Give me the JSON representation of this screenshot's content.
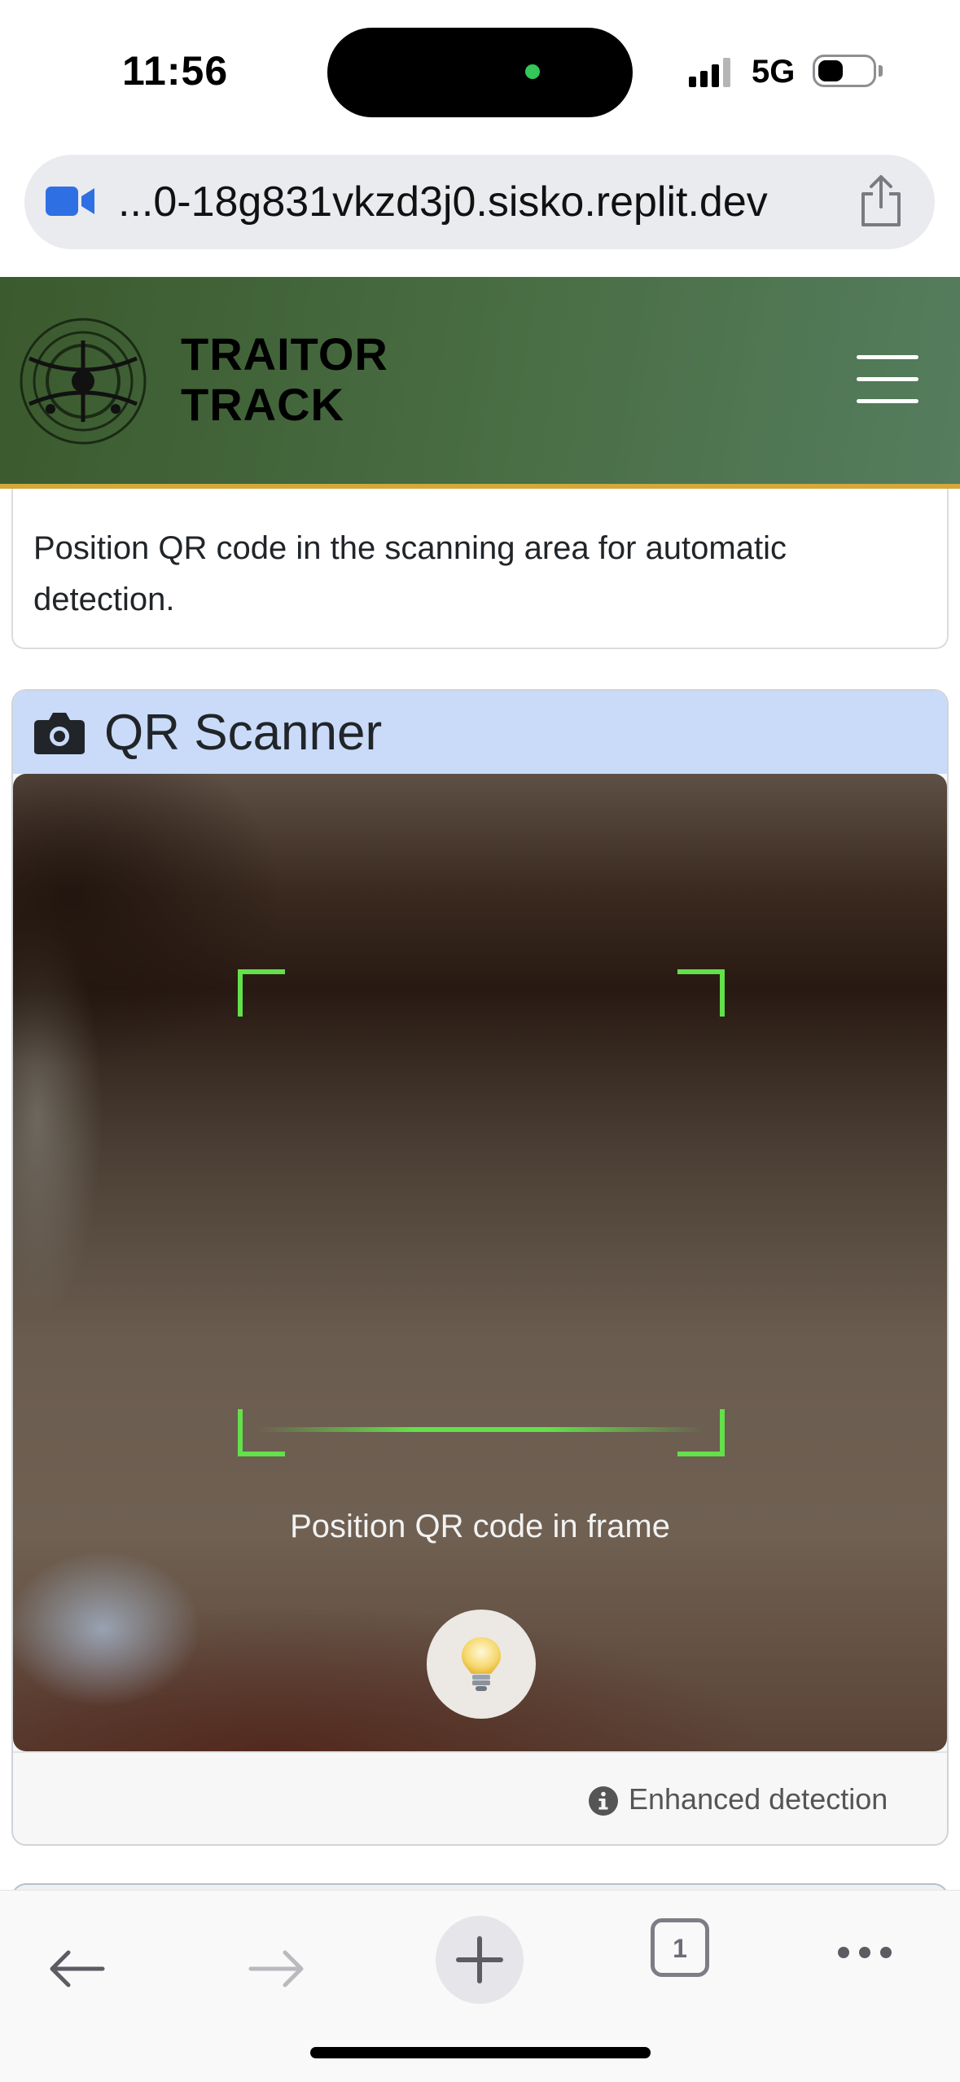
{
  "status_bar": {
    "time": "11:56",
    "network": "5G",
    "battery_level": 0.45
  },
  "browser": {
    "url": "...0-18g831vkzd3j0.sisko.replit.dev",
    "tab_count": "1"
  },
  "header": {
    "brand_line1": "TRAITOR",
    "brand_line2": "TRACK",
    "gradient_start": "#3b5a2e",
    "gradient_end": "#557d5e",
    "accent_border": "#d4a83a"
  },
  "info_card": {
    "text": "Position QR code in the scanning area for automatic detection."
  },
  "scanner": {
    "title": "QR Scanner",
    "header_color": "#c9dbf8",
    "frame_color": "#63e04a",
    "frame_hint": "Position QR code in frame",
    "torch_icon": "lightbulb-icon",
    "footer_label": "Enhanced detection"
  }
}
